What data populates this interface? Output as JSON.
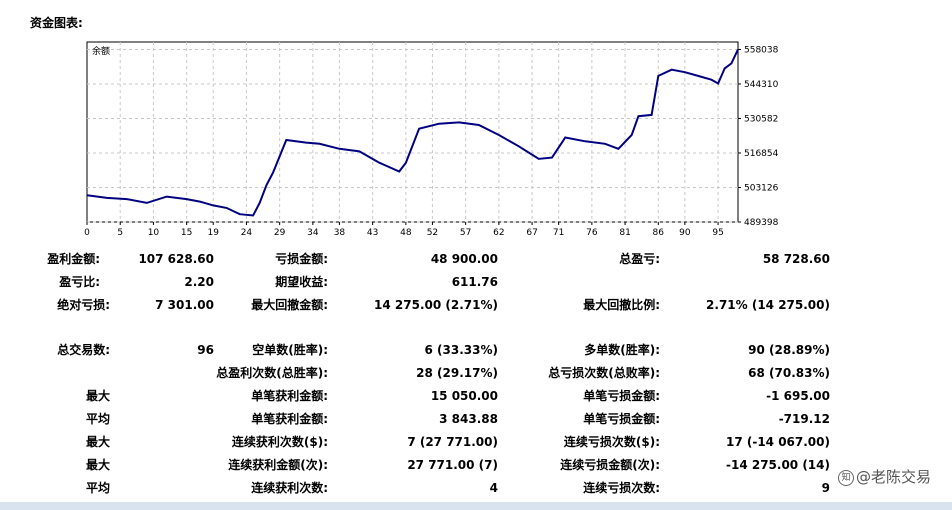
{
  "section_title": "资金图表:",
  "chart_data": {
    "type": "line",
    "title": "",
    "series_label": "余额",
    "xlim": [
      0,
      98
    ],
    "ylim": [
      489398,
      561000
    ],
    "x_ticks": [
      0,
      5,
      10,
      15,
      19,
      24,
      29,
      34,
      38,
      43,
      48,
      52,
      57,
      62,
      67,
      71,
      76,
      81,
      86,
      90,
      95
    ],
    "y_ticks": [
      489398,
      503126,
      516854,
      530582,
      544310,
      558038
    ],
    "grid": true,
    "line_color": "#000080",
    "series": [
      {
        "name": "余额",
        "x": [
          0,
          3,
          6,
          9,
          12,
          15,
          17,
          19,
          21,
          23,
          25,
          26,
          27,
          28,
          30,
          33,
          35,
          38,
          41,
          44,
          47,
          48,
          50,
          53,
          56,
          59,
          62,
          65,
          68,
          70,
          72,
          75,
          78,
          80,
          82,
          83,
          85,
          86,
          88,
          90,
          92,
          94,
          95,
          96,
          97,
          98
        ],
        "values": [
          500000,
          499000,
          498500,
          497000,
          499500,
          498500,
          497500,
          496000,
          495000,
          492500,
          492000,
          497000,
          504000,
          509000,
          522000,
          521000,
          520500,
          518500,
          517500,
          513000,
          509500,
          513000,
          526500,
          528500,
          529000,
          528000,
          524000,
          519500,
          514500,
          515000,
          523000,
          521500,
          520500,
          518500,
          524000,
          531500,
          532000,
          547500,
          550000,
          549000,
          547500,
          546000,
          544500,
          550500,
          552500,
          558038
        ]
      }
    ]
  },
  "stats": {
    "gross_profit": {
      "label": "盈利金额:",
      "value": "107 628.60"
    },
    "gross_loss": {
      "label": "亏损金额:",
      "value": "48 900.00"
    },
    "net_profit": {
      "label": "总盈亏:",
      "value": "58 728.60"
    },
    "profit_factor": {
      "label": "盈亏比:",
      "value": "2.20"
    },
    "expected_payoff": {
      "label": "期望收益:",
      "value": "611.76"
    },
    "absolute_drawdown": {
      "label": "绝对亏损:",
      "value": "7 301.00"
    },
    "max_drawdown": {
      "label": "最大回撤金额:",
      "value": "14 275.00 (2.71%)"
    },
    "relative_drawdown": {
      "label": "最大回撤比例:",
      "value": "2.71% (14 275.00)"
    },
    "total_trades": {
      "label": "总交易数:",
      "value": "96"
    },
    "short_positions": {
      "label": "空单数(胜率):",
      "value": "6 (33.33%)"
    },
    "long_positions": {
      "label": "多单数(胜率):",
      "value": "90 (28.89%)"
    },
    "profit_trades": {
      "label": "总盈利次数(总胜率):",
      "value": "28 (29.17%)"
    },
    "loss_trades": {
      "label": "总亏损次数(总败率):",
      "value": "68 (70.83%)"
    },
    "largest_row": {
      "group": "最大",
      "profit_label": "单笔获利金额:",
      "profit_value": "15 050.00",
      "loss_label": "单笔亏损金额:",
      "loss_value": "-1 695.00"
    },
    "average_row": {
      "group": "平均",
      "profit_label": "单笔获利金额:",
      "profit_value": "3 843.88",
      "loss_label": "单笔亏损金额:",
      "loss_value": "-719.12"
    },
    "max_consec_count_row": {
      "group": "最大",
      "profit_label": "连续获利次数($):",
      "profit_value": "7 (27 771.00)",
      "loss_label": "连续亏损次数($):",
      "loss_value": "17 (-14 067.00)"
    },
    "max_consec_amount_row": {
      "group": "最大",
      "profit_label": "连续获利金额(次):",
      "profit_value": "27 771.00 (7)",
      "loss_label": "连续亏损金额(次):",
      "loss_value": "-14 275.00 (14)"
    },
    "avg_consec_row": {
      "group": "平均",
      "profit_label": "连续获利次数:",
      "profit_value": "4",
      "loss_label": "连续亏损次数:",
      "loss_value": "9"
    }
  },
  "watermark": {
    "icon": "zhihu-icon",
    "text": "@老陈交易"
  }
}
